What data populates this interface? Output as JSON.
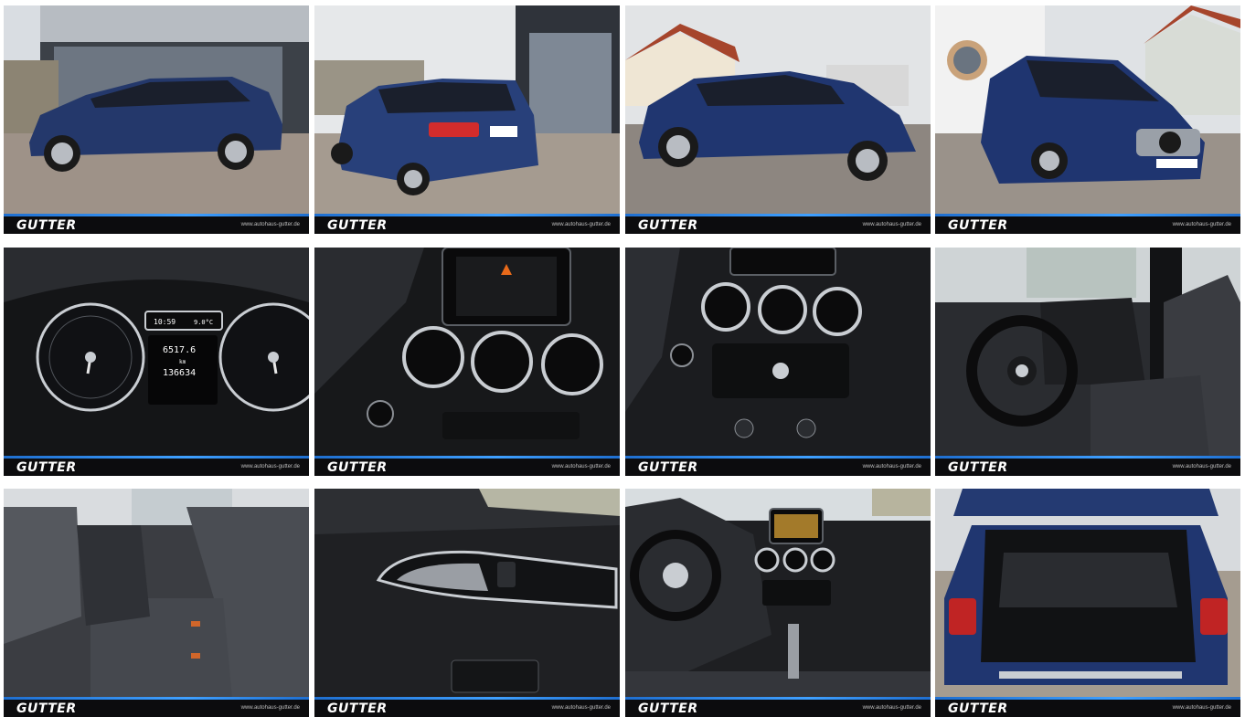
{
  "brand": {
    "logo_text": "GUTTER",
    "website": "www.autohaus-gutter.de",
    "accent_color": "#2a8cf0"
  },
  "photos": [
    {
      "subject": "Blue Mercedes-Benz B-Class side view in front of dealership"
    },
    {
      "subject": "Rear three-quarter view of blue B-Class"
    },
    {
      "subject": "Side view of blue B-Class on street"
    },
    {
      "subject": "Front three-quarter view of blue B-Class"
    },
    {
      "subject": "Instrument cluster",
      "cluster": {
        "time": "10:59",
        "temperature": "9.0°C",
        "trip": "6517.6",
        "unit": "km",
        "odometer": "136634"
      }
    },
    {
      "subject": "Center console with display and air vents"
    },
    {
      "subject": "Air vents and radio controls"
    },
    {
      "subject": "Driver seat and steering wheel"
    },
    {
      "subject": "Rear seats"
    },
    {
      "subject": "Door panel interior"
    },
    {
      "subject": "Dashboard overview"
    },
    {
      "subject": "Open trunk / cargo area"
    }
  ]
}
